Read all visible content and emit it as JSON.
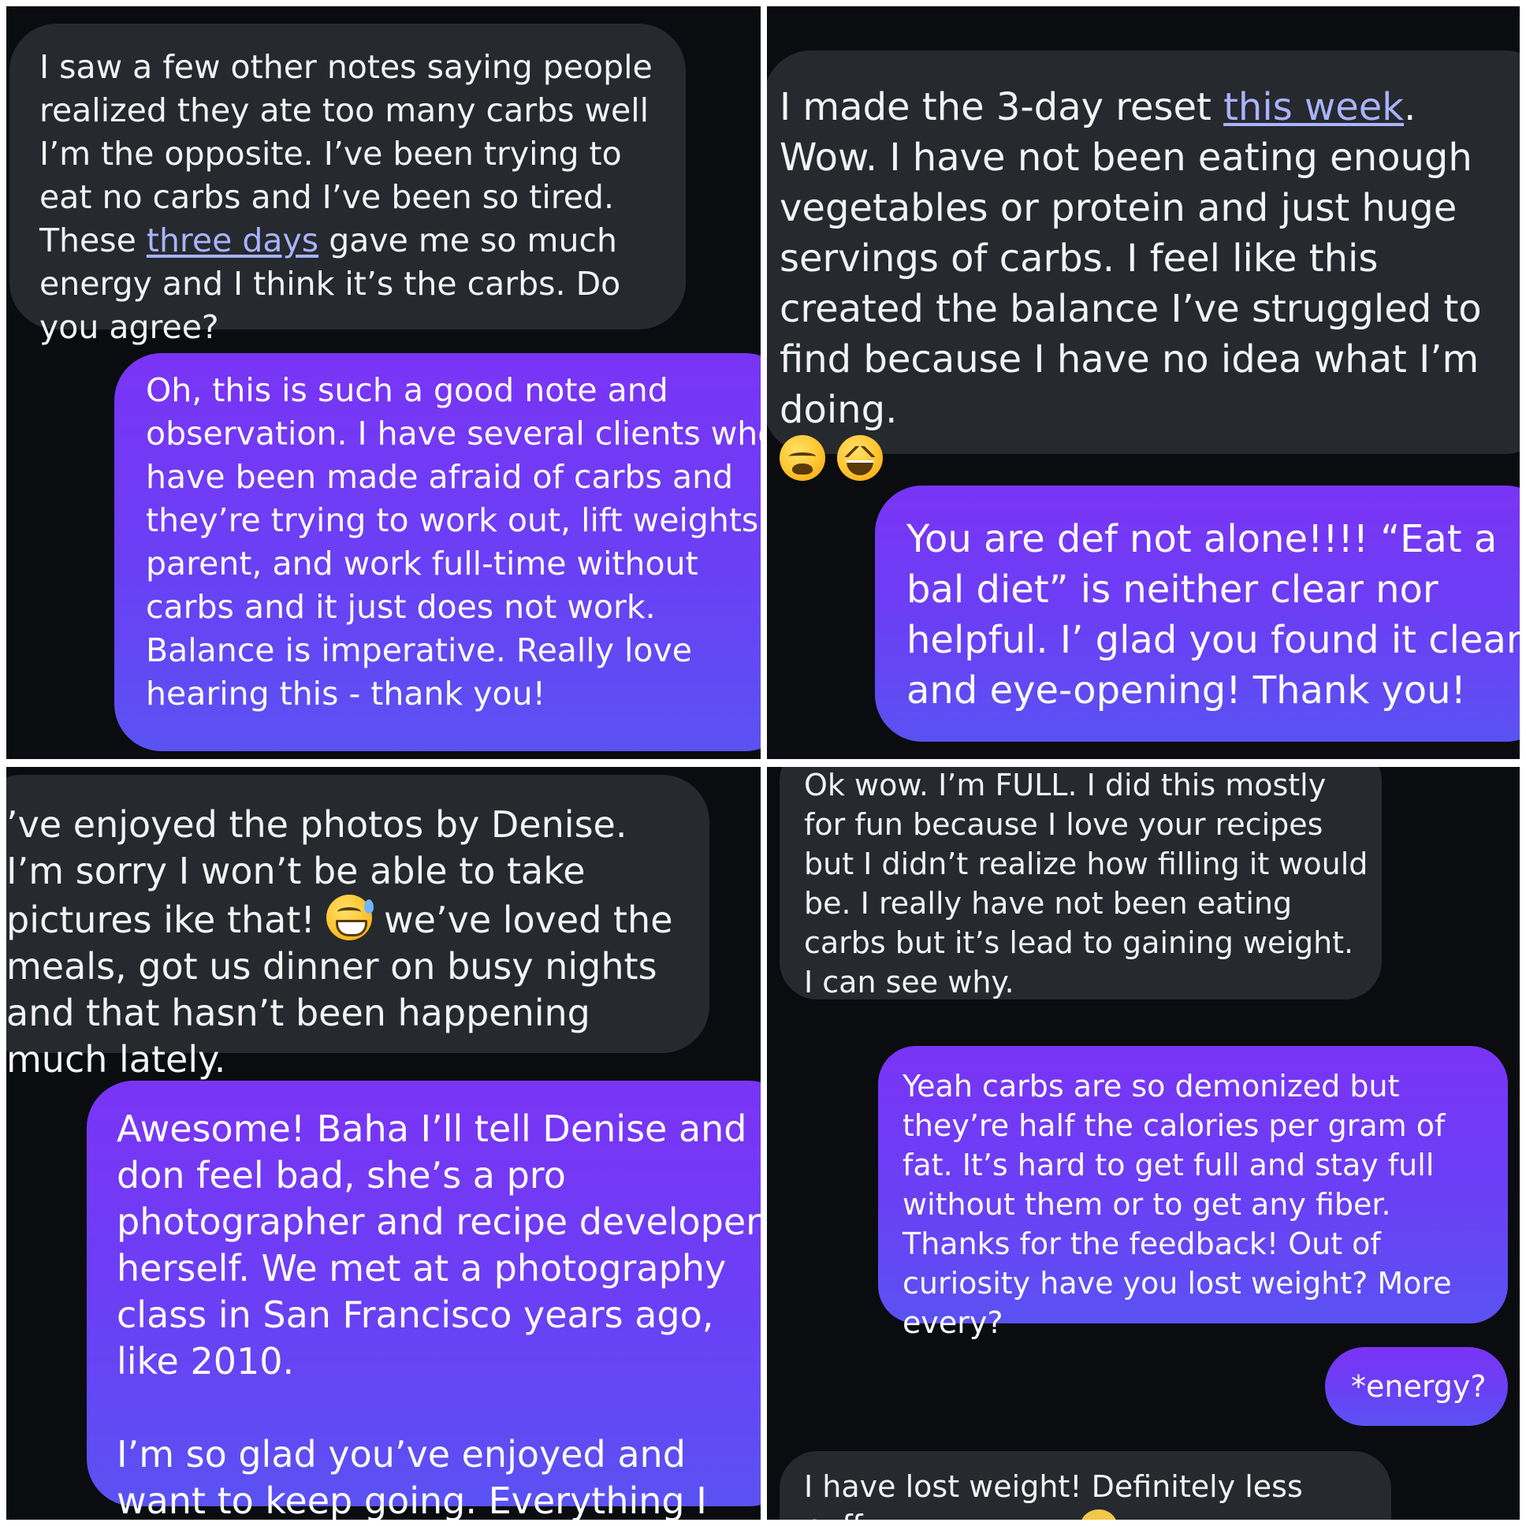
{
  "panel_top_left": {
    "incoming_before_link": "I saw a few other notes saying people realized they ate too many carbs well I’m the opposite. I’ve been trying to eat no carbs and I’ve been so tired. These ",
    "incoming_link": "three days",
    "incoming_after_link": " gave me so much energy and I think it’s the carbs. Do you agree?",
    "reply": "Oh, this is such a good note and observation. I have several clients who have been made afraid of carbs and they’re trying to work out, lift weights, parent, and work full-time without carbs and it just does not work. Balance is imperative. Really love hearing this - thank you!"
  },
  "panel_top_right": {
    "incoming_before_link": "I made the 3-day reset ",
    "incoming_link": "this week",
    "incoming_after_link": ". Wow. I have not been eating enough vegetables or protein and just huge servings of carbs. I feel like this created the balance I’ve struggled to find because I have no idea what I’m doing.",
    "emoji_1": "weary-face-emoji",
    "emoji_2": "squinting-laughing-face-emoji",
    "reply": "You are def not alone!!!! “Eat a bal diet” is neither clear nor helpful. I’ glad you found it clear and eye-opening! Thank you!"
  },
  "panel_bottom_left": {
    "incoming_part1": "’ve enjoyed the photos by Denise. I’m sorry I won’t be able to take pictures ike that! ",
    "emoji": "grinning-sweat-face-emoji",
    "incoming_part2": " we’ve loved the meals, got us dinner on busy nights and that hasn’t been happening much lately.",
    "reply_para1": "Awesome! Baha I’ll tell Denise and don feel bad, she’s a pro photographer and recipe developer herself. We met at a photography class in San Francisco years ago, like 2010.",
    "reply_para2": "I’m so glad you’ve enjoyed and want to keep going. Everything I hoped for!"
  },
  "panel_bottom_right": {
    "incoming_1": "Ok wow. I’m FULL. I did this mostly for fun because I love your recipes but I didn’t realize how filling it would be. I really have not been eating carbs but it’s lead to gaining weight. I can see why.",
    "reply_1": "Yeah carbs are so demonized but they’re half the calories per gram of fat. It’s hard to get full and stay full without them or to get any fiber. Thanks for the feedback! Out of curiosity have you lost weight? More every?",
    "reply_2": "*energy?",
    "incoming_2": "I have lost weight! Definitely less puffy.",
    "emoji": "party-face-emoji"
  },
  "colors": {
    "background": "#0a0c10",
    "incoming_bubble": "#26292e",
    "outgoing_gradient_top": "#7a34f5",
    "outgoing_gradient_bottom": "#5a52f2",
    "link": "#a9b3ff",
    "divider": "#ffffff"
  }
}
